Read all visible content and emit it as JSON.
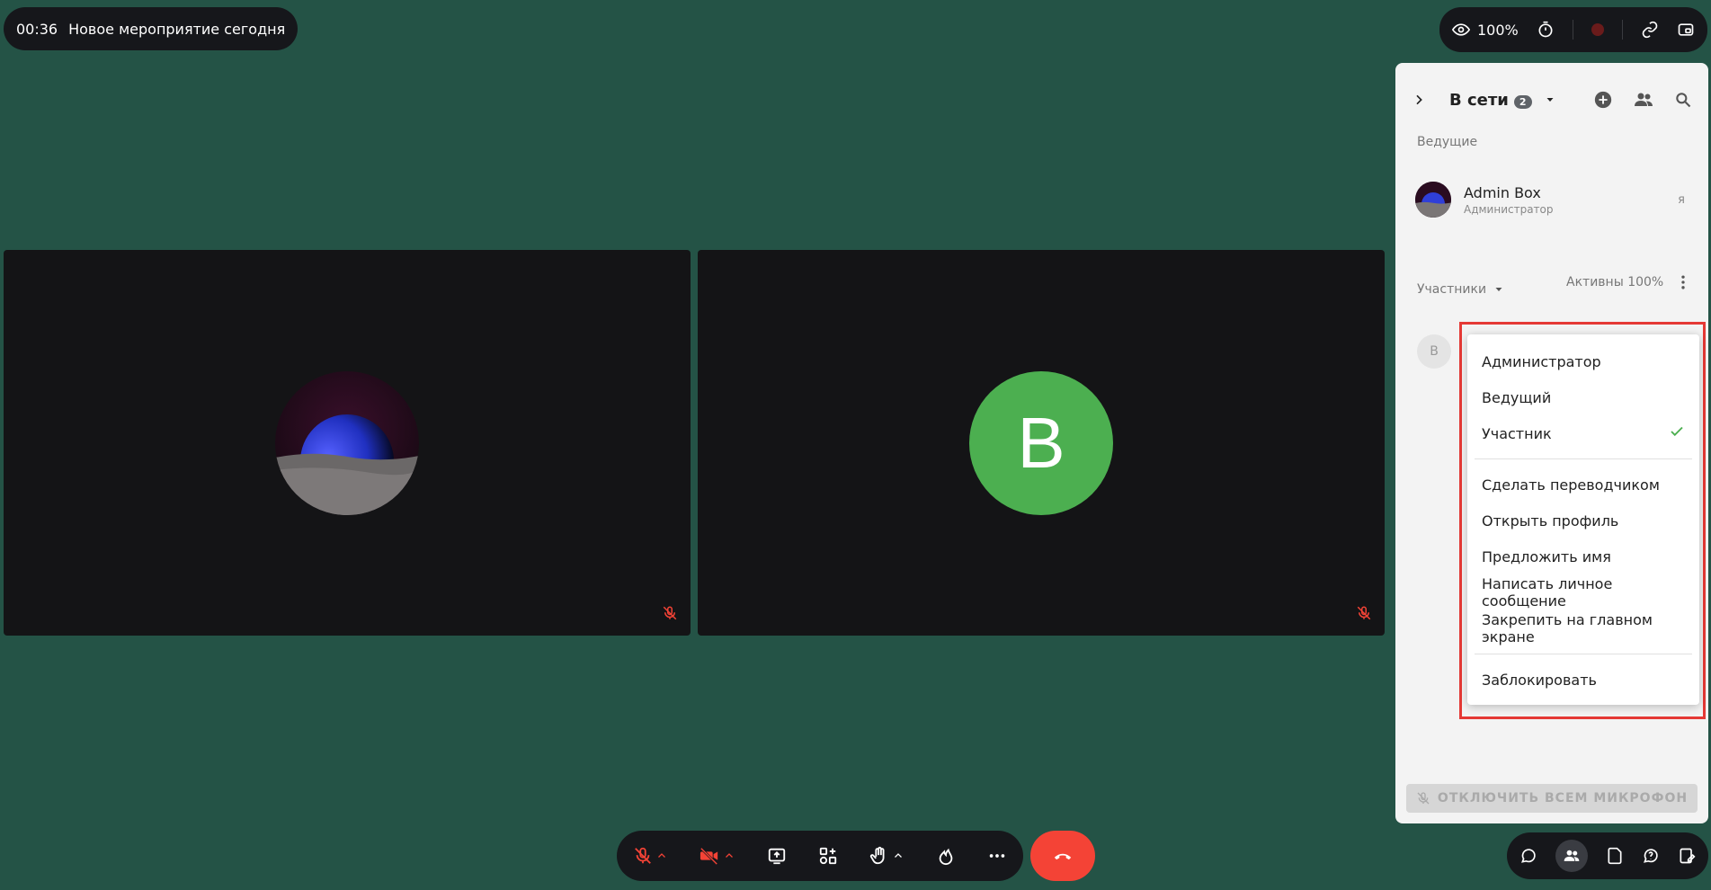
{
  "meeting": {
    "time": "00:36",
    "title": "Новое мероприятие сегодня"
  },
  "top_bar": {
    "view_percent": "100%",
    "icons": [
      "eye-icon",
      "timer-icon",
      "record-icon",
      "link-icon",
      "picture-in-picture-icon"
    ]
  },
  "tiles": [
    {
      "name": "participant-tile-admin",
      "avatar": "planet-image",
      "mic_status": "muted"
    },
    {
      "name": "participant-tile-b",
      "avatar_letter": "B",
      "avatar_color": "#4caf50",
      "mic_status": "muted"
    }
  ],
  "side_panel": {
    "title": "В сети",
    "online_count": "2",
    "hosts_label": "Ведущие",
    "host": {
      "name": "Admin Box",
      "role": "Администратор",
      "me_label": "я"
    },
    "participants_label": "Участники",
    "active_label": "Активны 100%",
    "participant_b_initial": "B",
    "mute_all_label": "ОТКЛЮЧИТЬ ВСЕМ МИКРОФОН"
  },
  "role_menu": {
    "roles": [
      {
        "label": "Администратор",
        "checked": false
      },
      {
        "label": "Ведущий",
        "checked": false
      },
      {
        "label": "Участник",
        "checked": true
      }
    ],
    "actions": [
      "Сделать переводчиком",
      "Открыть профиль",
      "Предложить имя",
      "Написать личное сообщение",
      "Закрепить на главном экране"
    ],
    "danger": "Заблокировать"
  },
  "colors": {
    "background": "#245346",
    "end_call": "#f44336",
    "muted": "#f44336",
    "check": "#4caf50",
    "highlight": "#e53935"
  }
}
